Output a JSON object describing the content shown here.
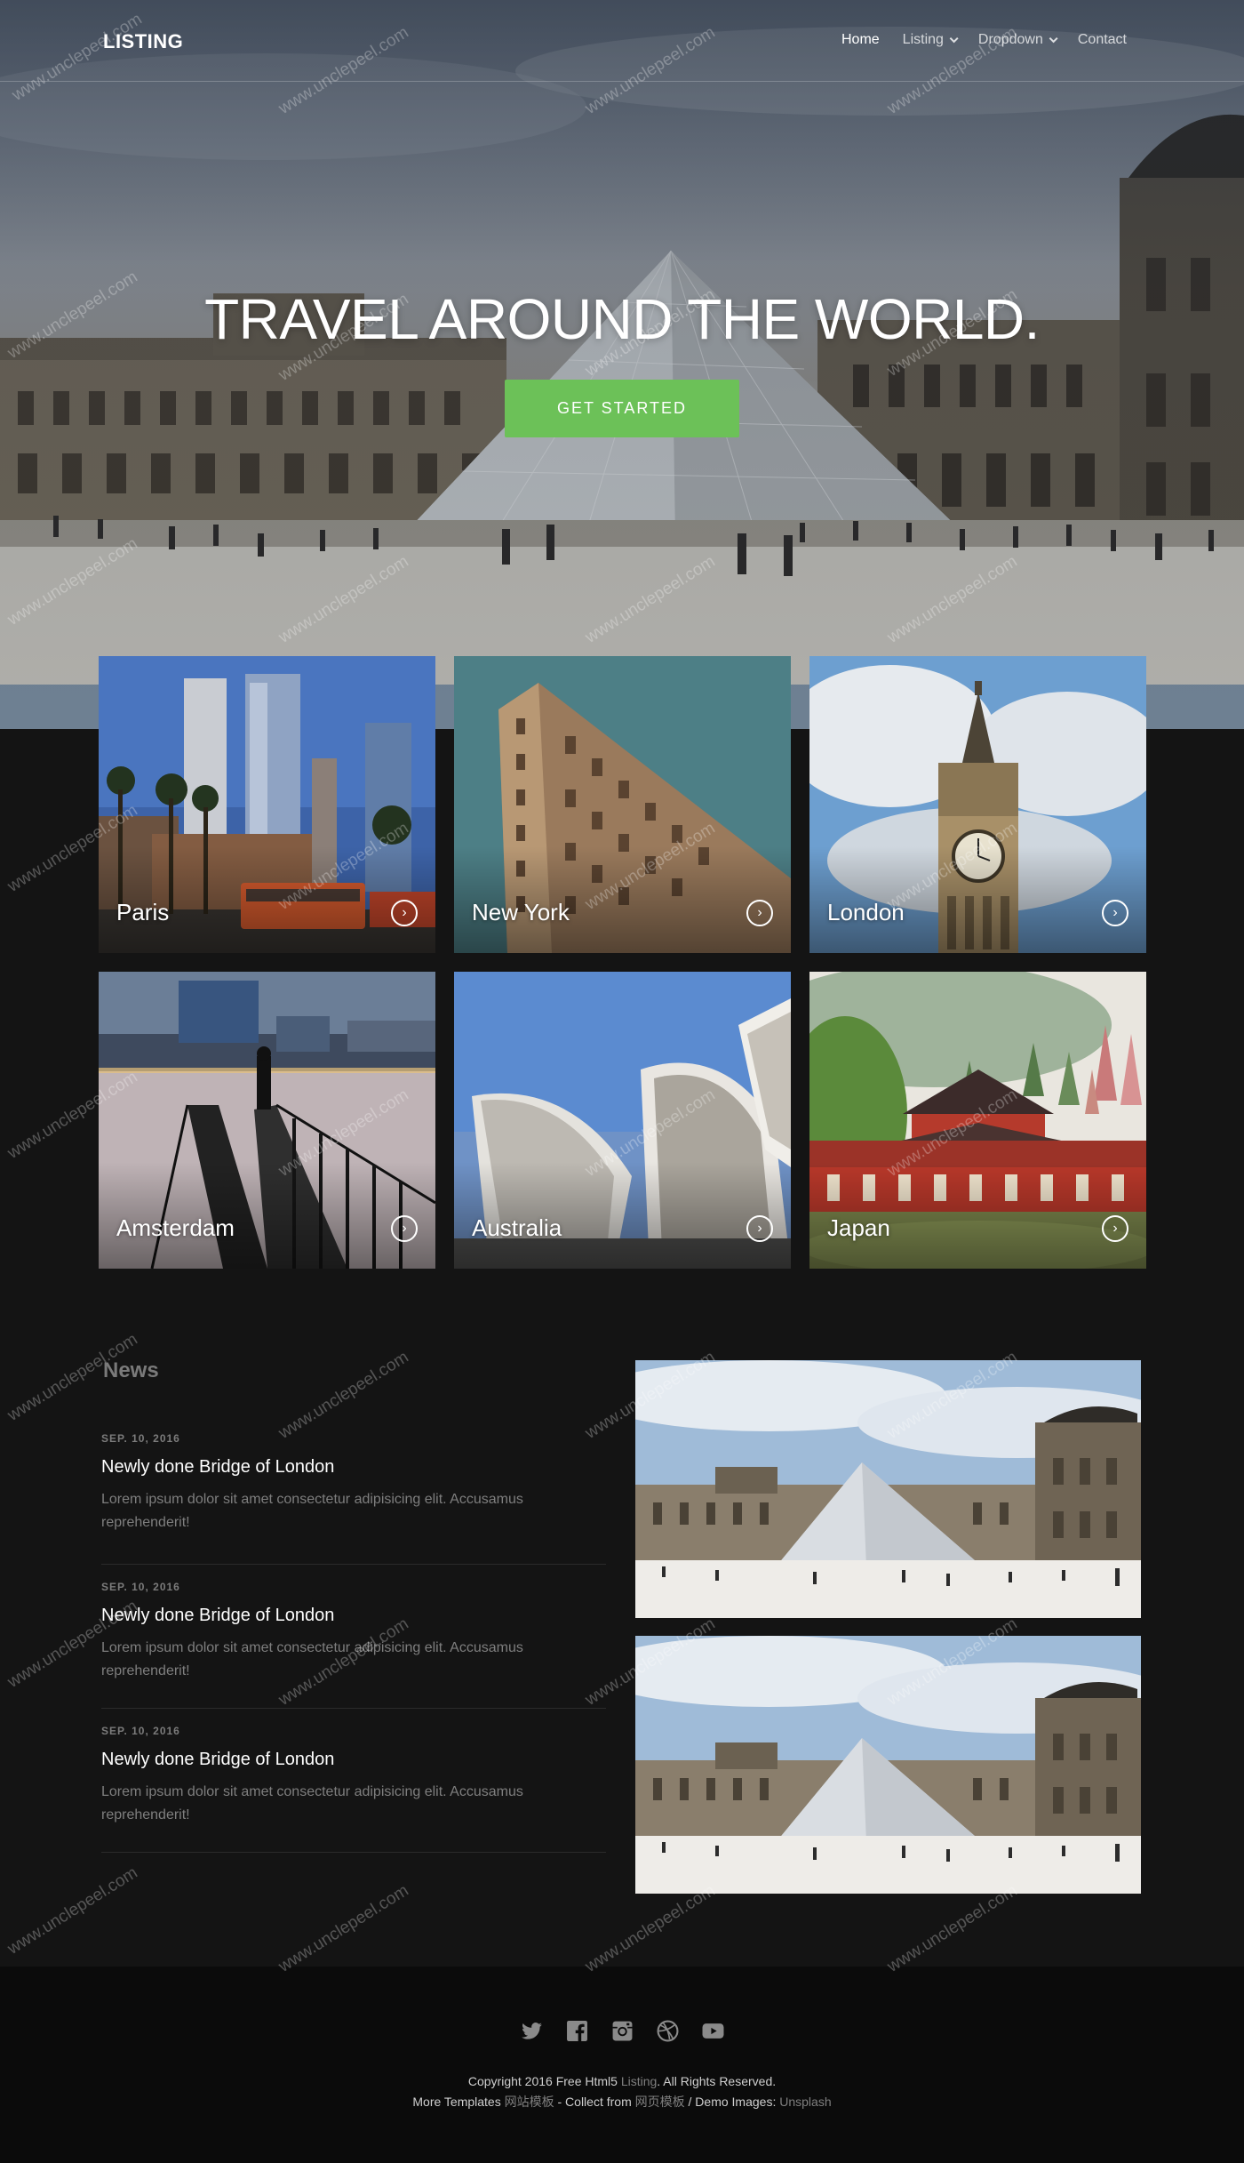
{
  "nav": {
    "logo": "LISTING",
    "items": [
      {
        "label": "Home",
        "active": true,
        "has_dropdown": false
      },
      {
        "label": "Listing",
        "active": false,
        "has_dropdown": true
      },
      {
        "label": "Dropdown",
        "active": false,
        "has_dropdown": true
      },
      {
        "label": "Contact",
        "active": false,
        "has_dropdown": false
      }
    ]
  },
  "hero": {
    "title": "TRAVEL AROUND THE WORLD.",
    "cta_label": "GET STARTED"
  },
  "cities": [
    {
      "name": "Paris",
      "icon": "chevron-right-circle-icon"
    },
    {
      "name": "New York",
      "icon": "chevron-right-circle-icon"
    },
    {
      "name": "London",
      "icon": "chevron-right-circle-icon"
    },
    {
      "name": "Amsterdam",
      "icon": "chevron-right-circle-icon"
    },
    {
      "name": "Australia",
      "icon": "chevron-right-circle-icon"
    },
    {
      "name": "Japan",
      "icon": "chevron-right-circle-icon"
    }
  ],
  "news": {
    "heading": "News",
    "items": [
      {
        "date": "SEP. 10, 2016",
        "title": "Newly done Bridge of London",
        "text": "Lorem ipsum dolor sit amet consectetur adipisicing elit. Accusamus reprehenderit!"
      },
      {
        "date": "SEP. 10, 2016",
        "title": "Newly done Bridge of London",
        "text": "Lorem ipsum dolor sit amet consectetur adipisicing elit. Accusamus reprehenderit!"
      },
      {
        "date": "SEP. 10, 2016",
        "title": "Newly done Bridge of London",
        "text": "Lorem ipsum dolor sit amet consectetur adipisicing elit. Accusamus reprehenderit!"
      }
    ]
  },
  "footer": {
    "social_icons": [
      "twitter-icon",
      "facebook-icon",
      "instagram-icon",
      "dribbble-icon",
      "youtube-icon"
    ],
    "copyright_prefix": "Copyright 2016 Free Html5",
    "copyright_link": "Listing",
    "copyright_suffix": ". All Rights Reserved.",
    "more_prefix": "More Templates",
    "more_link": "网站模板",
    "collect_prefix": "- Collect from",
    "collect_link": "网页模板",
    "images_prefix": "/ Demo Images:",
    "images_link": "Unsplash"
  },
  "watermark": "www.unclepeel.com",
  "colors": {
    "accent": "#6cc158",
    "background": "#141414",
    "footer": "#0b0b0b"
  }
}
